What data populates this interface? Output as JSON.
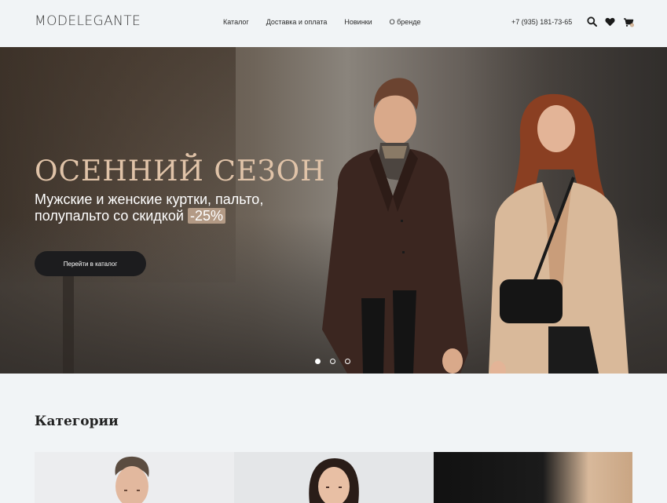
{
  "header": {
    "logo": "MODELEGANTE",
    "nav": [
      "Каталог",
      "Доставка и оплата",
      "Новинки",
      "О бренде"
    ],
    "phone": "+7 (935) 181-73-65",
    "icons": [
      "search-icon",
      "heart-icon",
      "cart-icon"
    ],
    "cart_count": "0"
  },
  "hero": {
    "title": "ОСЕННИЙ СЕЗОН",
    "subtitle": "Мужские и женские куртки, пальто, полупальто со скидкой",
    "discount": "-25%",
    "button_label": "Перейти в каталог",
    "slides": 3,
    "active_slide": 1
  },
  "categories": {
    "title": "Категории"
  },
  "colors": {
    "background": "#f1f4f6",
    "accent_title": "#e0c3a8",
    "button_bg": "#1c1c1e",
    "badge_bg": "#b39a85"
  }
}
